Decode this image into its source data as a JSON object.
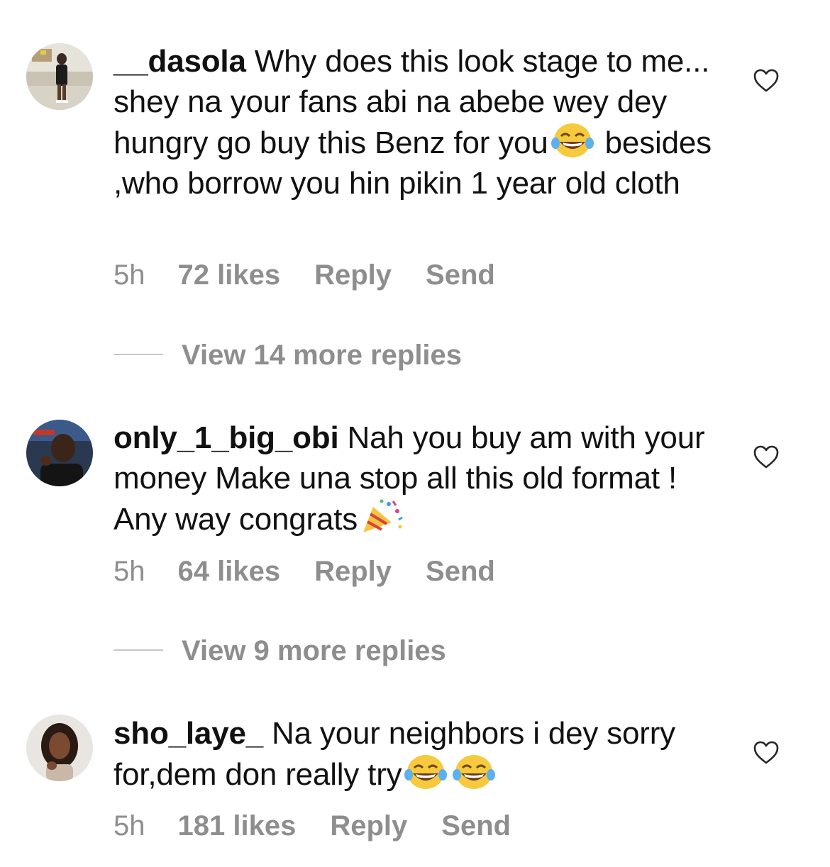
{
  "comments": [
    {
      "username": "__dasola",
      "text_part1": "Why does this look stage to me... shey na your fans abi na abebe wey dey hungry go buy this Benz for you",
      "text_part2": " besides ,who borrow you hin pikin 1 year old cloth",
      "emoji": "joy-emoji",
      "time": "5h",
      "likes": "72 likes",
      "reply_label": "Reply",
      "send_label": "Send",
      "view_replies": "View 14 more replies"
    },
    {
      "username": "only_1_big_obi",
      "text_part1": "Nah you buy am with your money Make una stop all this old format ! Any way congrats",
      "emoji": "party-popper-emoji",
      "time": "5h",
      "likes": "64 likes",
      "reply_label": "Reply",
      "send_label": "Send",
      "view_replies": "View 9 more replies"
    },
    {
      "username": "sho_laye_",
      "text_part1": "Na your neighbors i dey sorry for,dem don really try",
      "emoji": "joy-emoji",
      "time": "5h",
      "likes": "181 likes",
      "reply_label": "Reply",
      "send_label": "Send"
    }
  ],
  "colors": {
    "text": "#111111",
    "muted": "#8e8e8e",
    "divider": "#c7c7c7"
  }
}
